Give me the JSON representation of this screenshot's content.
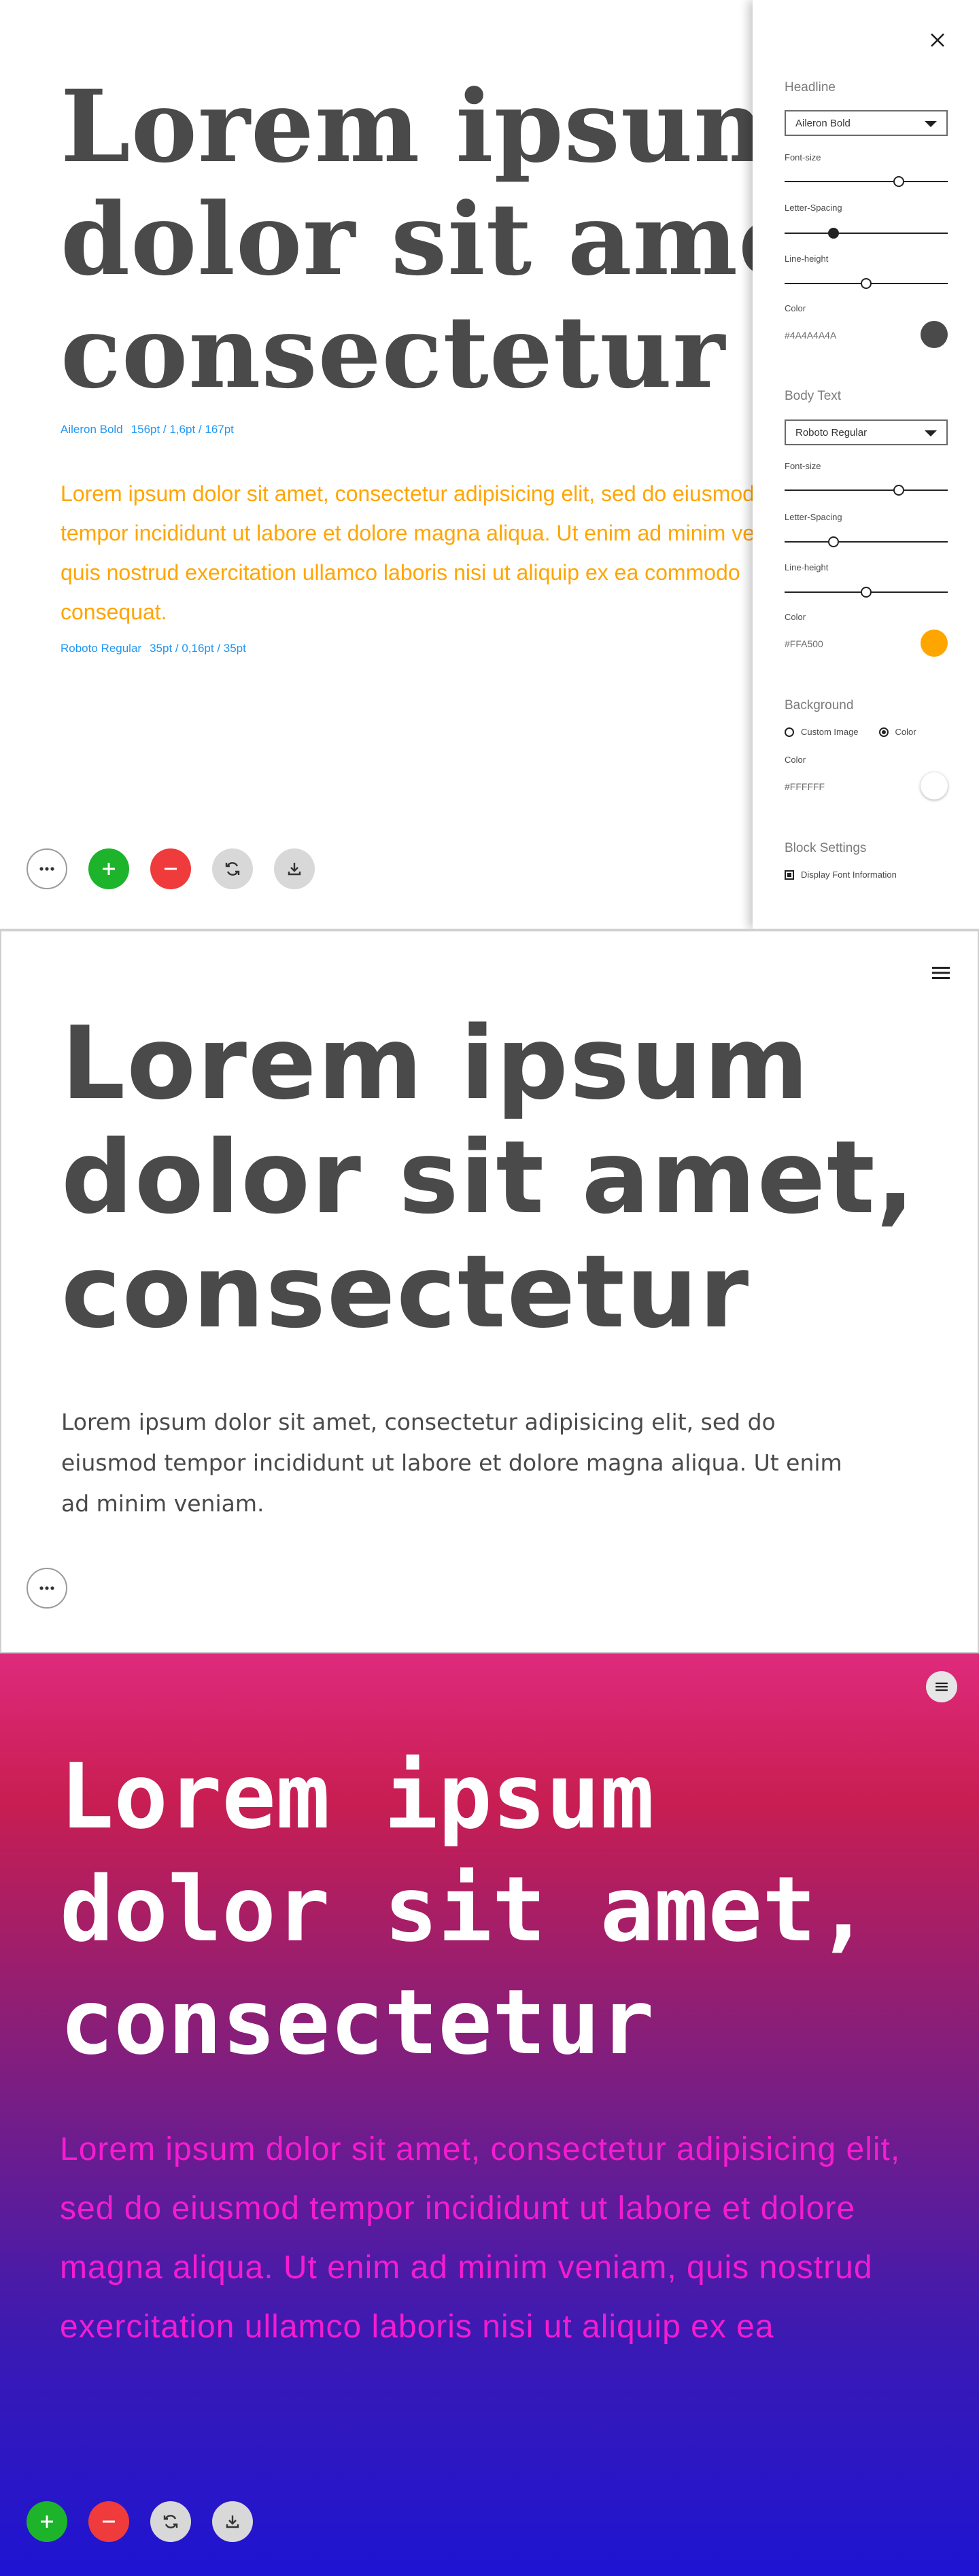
{
  "block1": {
    "headline_lines": [
      "Lorem ipsum",
      "dolor sit amet,",
      "consectetur"
    ],
    "headline_info": {
      "font": "Aileron Bold",
      "spec": "156pt / 1,6pt / 167pt"
    },
    "body": "Lorem ipsum dolor sit amet, consectetur adipisicing elit, sed do eiusmod tempor incididunt ut labore et dolore magna aliqua. Ut enim ad minim veniam, quis nostrud exercitation ullamco laboris nisi ut aliquip ex ea commodo consequat.",
    "body_info": {
      "font": "Roboto Regular",
      "spec": "35pt / 0,16pt / 35pt"
    },
    "colors": {
      "headline": "#4A4A4A",
      "body": "#FFA500",
      "info": "#2196F3"
    },
    "actions": [
      "more-icon",
      "plus-icon",
      "minus-icon",
      "refresh-icon",
      "download-icon"
    ]
  },
  "settings_panel": {
    "headline": {
      "title": "Headline",
      "font_selected": "Aileron Bold",
      "font_size_label": "Font-size",
      "font_size_value": 0.7,
      "letter_spacing_label": "Letter-Spacing",
      "letter_spacing_value": 0.3,
      "line_height_label": "Line-height",
      "line_height_value": 0.5,
      "color_label": "Color",
      "color_hex": "#4A4A4A4A",
      "swatch": "#4A4A4A"
    },
    "body_text": {
      "title": "Body Text",
      "font_selected": "Roboto Regular",
      "font_size_label": "Font-size",
      "font_size_value": 0.7,
      "letter_spacing_label": "Letter-Spacing",
      "letter_spacing_value": 0.3,
      "line_height_label": "Line-height",
      "line_height_value": 0.5,
      "color_label": "Color",
      "color_hex": "#FFA500",
      "swatch": "#FFA500"
    },
    "background": {
      "title": "Background",
      "option_custom": "Custom Image",
      "option_color": "Color",
      "selected": "Color",
      "color_label": "Color",
      "color_hex": "#FFFFFF",
      "swatch": "#FFFFFF"
    },
    "block_settings": {
      "title": "Block Settings",
      "display_font_info": "Display Font Information",
      "display_font_info_checked": true
    }
  },
  "block2": {
    "headline_lines": [
      "Lorem ipsum",
      "dolor sit amet,",
      "consectetur"
    ],
    "body": "Lorem ipsum dolor sit amet, consectetur adipisicing elit, sed do eiusmod tempor incididunt ut labore et dolore magna aliqua. Ut enim ad minim veniam.",
    "colors": {
      "headline": "#4A4A4A",
      "body": "#4A4A4A"
    }
  },
  "block3": {
    "headline_lines": [
      "Lorem ipsum",
      "dolor sit amet,",
      "consectetur"
    ],
    "body": "Lorem ipsum dolor sit amet, consectetur adipisicing elit, sed do eiusmod tempor incididunt ut labore et dolore magna aliqua. Ut enim ad minim veniam, quis nostrud exercitation ullamco laboris nisi ut aliquip ex ea",
    "colors": {
      "headline": "#FFFFFF",
      "body": "#F51CD0",
      "gradient_top": "#DF2A7C",
      "gradient_bottom": "#1E14D2"
    }
  }
}
